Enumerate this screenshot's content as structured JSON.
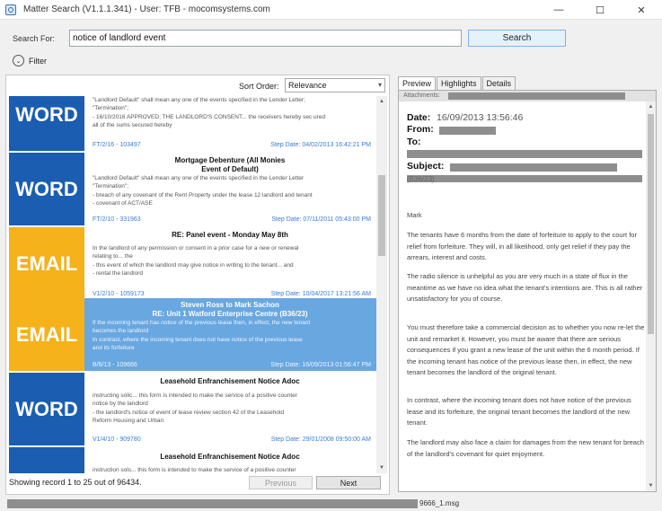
{
  "window": {
    "title": "Matter Search (V1.1.1.341) - User: TFB - mocomsystems.com",
    "minimize": "—",
    "maximize": "☐",
    "close": "✕"
  },
  "search": {
    "label": "Search For:",
    "value": "notice of landlord event",
    "button": "Search"
  },
  "filter": {
    "label": "Filter",
    "toggle_glyph": "⌄"
  },
  "sort": {
    "label": "Sort Order:",
    "value": "Relevance"
  },
  "results": [
    {
      "type": "WORD",
      "title": "",
      "subtitle": "",
      "selected": false,
      "lines": [
        "\"Landlord Default\" shall mean any one of the events specified in the Lender Letter;",
        "\"Termination\";",
        "- 16/10/2016 APPROVED; THE LANDLORD'S CONSENT... the receivers hereby sec ured",
        "all of the sums secured hereby"
      ],
      "id": "FT/2/16 - 103497",
      "date": "Step Date: 04/02/2013 16:42:21 PM"
    },
    {
      "type": "WORD",
      "title": "Mortgage Debenture (All Monies",
      "subtitle": "Event of Default)",
      "selected": false,
      "lines": [
        "\"Landlord Default\" shall mean any one of the events specified in the Lender Letter",
        "\"Termination\";",
        "- breach of any covenant of the Rent Property under the lease 12 landlord and tenant",
        "- covenant of ACT/ASE"
      ],
      "id": "FT/2/10 - 331963",
      "date": "Step Date: 07/11/2011 05:43:00 PM"
    },
    {
      "type": "EMAIL",
      "title": "RE: Panel event - Monday May 8th",
      "subtitle": "",
      "selected": false,
      "lines": [
        "In the landlord of any permission or consent in a prior case for a new or renewal",
        "relating to... the",
        "- this event of which the landlord may give notice in writing to the tenant... and",
        "- rental the landlord"
      ],
      "id": "V1/2/10 - 1059173",
      "date": "Step Date: 10/04/2017 13:21:56 AM"
    },
    {
      "type": "EMAIL",
      "title": "Steven Ross to Mark Sachon",
      "subtitle": "RE: Unit 1 Watford Enterprise Centre (B36/23)",
      "selected": true,
      "lines": [
        "If the incoming tenant has notice of the previous lease then, in effect, the new tenant",
        "becomes the landlord",
        "In contrast, where the incoming tenant does not have notice of the previous lease",
        "and its forfeiture"
      ],
      "id": "B/6/13 - 109666",
      "date": "Step Date: 16/09/2013 01:56:47 PM"
    },
    {
      "type": "WORD",
      "title": "Leasehold Enfranchisement Notice Adoc",
      "subtitle": "",
      "selected": false,
      "lines": [
        "instructing solic... this form is intended to make the service of a positive counter",
        "notice by the landlord",
        "- the landlord's notice of event of lease review section 42 of the Leasehold",
        "Reform Housing and Urban"
      ],
      "id": "V1/4/10 - 909780",
      "date": "Step Date: 29/01/2008 09:50:00 AM"
    },
    {
      "type": "WORD",
      "title": "Leasehold Enfranchisement Notice Adoc",
      "subtitle": "",
      "selected": false,
      "lines": [
        "instruction sols... this form is intended to make the service of a positive counter",
        "",
        "",
        ""
      ],
      "id": "",
      "date": ""
    }
  ],
  "status": {
    "text": "Showing record 1 to 25 out of 96434."
  },
  "paging": {
    "prev": "Previous",
    "next": "Next"
  },
  "tabs": [
    "Preview",
    "Highlights",
    "Details"
  ],
  "preview": {
    "attachments_label": "Attachments:",
    "date_label": "Date:",
    "date_value": "16/09/2013 13:56:46",
    "from_label": "From:",
    "to_label": "To:",
    "subject_label": "Subject:",
    "ref": "(B36/23)",
    "paragraphs": [
      "Mark",
      "The tenants have 6 months from the date of forfeiture to apply to the court for relief from forfeiture. They will, in all likelihood, only get relief if they pay the arrears, interest and costs.",
      "The radio silence is unhelpful as you are very much in a state of flux in the meantime as we have no idea what the tenant's intentions are. This is all rather unsatisfactory for you of course.",
      "You must therefore take a commercial decision as to whether you now re-let the unit and remarket it. However, you must be aware that there are serious consequences if you grant a new lease of the unit within the 6 month period. If the incoming tenant has notice of the previous lease then, in effect, the new tenant becomes the landlord of the original tenant.",
      "In contrast, where the incoming tenant does not have notice of the previous lease and its forfeiture, the original tenant becomes the landlord of the new tenant.",
      "The landlord may also face a claim for damages from the new tenant for breach of the landlord's covenant for quiet enjoyment."
    ]
  },
  "bottom": {
    "filename": "9666_1.msg"
  },
  "icons": {
    "app": "app-icon",
    "filter": "chevron-down-icon",
    "sort": "chevron-down-icon"
  }
}
